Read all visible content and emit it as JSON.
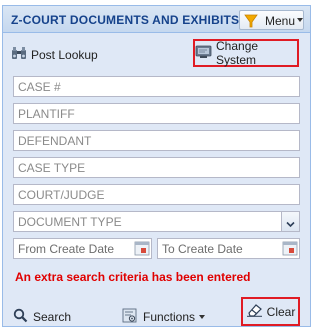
{
  "header": {
    "title": "Z-COURT DOCUMENTS AND EXHIBITS",
    "menu_label": "Menu"
  },
  "toolbar": {
    "post_lookup_label": "Post Lookup",
    "change_system_label": "Change System"
  },
  "fields": {
    "case_number": {
      "placeholder": "CASE #",
      "value": ""
    },
    "plaintiff": {
      "placeholder": "PLANTIFF",
      "value": ""
    },
    "defendant": {
      "placeholder": "DEFENDANT",
      "value": ""
    },
    "case_type": {
      "placeholder": "CASE TYPE",
      "value": ""
    },
    "court_judge": {
      "placeholder": "COURT/JUDGE",
      "value": ""
    },
    "document_type": {
      "placeholder": "DOCUMENT TYPE",
      "value": ""
    },
    "from_create_date": {
      "placeholder": "From Create Date",
      "value": ""
    },
    "to_create_date": {
      "placeholder": "To Create Date",
      "value": ""
    }
  },
  "warning_message": "An extra search criteria has been entered",
  "footer": {
    "search_label": "Search",
    "functions_label": "Functions",
    "clear_label": "Clear"
  },
  "colors": {
    "header_text": "#15428b",
    "panel_background": "#dfe8f6",
    "highlight_border": "#e01b24",
    "warning_text": "#e00000"
  }
}
